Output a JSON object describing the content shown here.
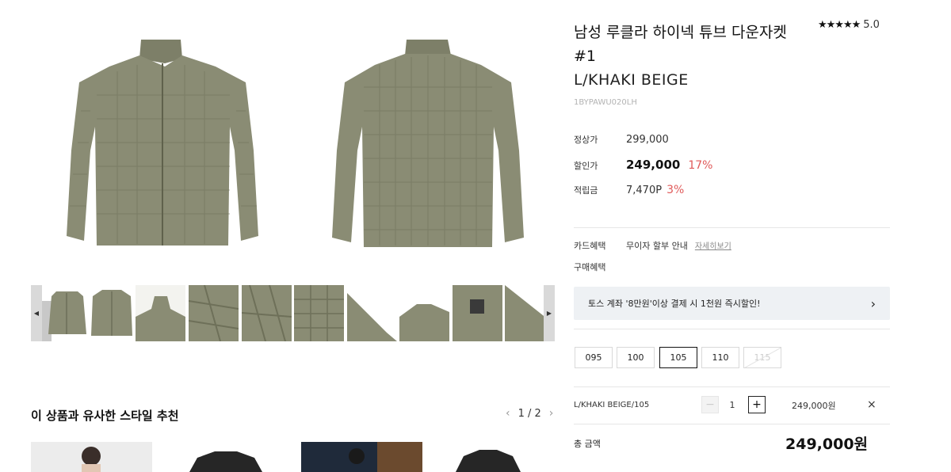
{
  "product": {
    "name_line1": "남성 루클라 하이넥 튜브 다운자켓",
    "name_line2": "#1",
    "color": "L/KHAKI BEIGE",
    "code": "1BYPAWU020LH",
    "rating_stars": "★★★★★",
    "rating_value": "5.0"
  },
  "prices": {
    "regular_label": "정상가",
    "regular_value": "299,000",
    "sale_label": "할인가",
    "sale_value": "249,000",
    "sale_pct": "17%",
    "points_label": "적립금",
    "points_value": "7,470P",
    "points_pct": "3%"
  },
  "benefits": {
    "card_label": "카드혜택",
    "card_value": "무이자 할부 안내",
    "card_link": "자세히보기",
    "purchase_label": "구매혜택"
  },
  "promo": {
    "text": "토스 계좌 '8만원'이상 결제 시 1천원 즉시할인!",
    "chevron": "›"
  },
  "sizes": [
    {
      "label": "095",
      "state": "normal"
    },
    {
      "label": "100",
      "state": "normal"
    },
    {
      "label": "105",
      "state": "selected"
    },
    {
      "label": "110",
      "state": "normal"
    },
    {
      "label": "115",
      "state": "disabled"
    }
  ],
  "selection": {
    "option": "L/KHAKI BEIGE/105",
    "minus": "−",
    "quantity": "1",
    "plus": "+",
    "price": "249,000원",
    "remove": "×"
  },
  "total": {
    "label": "총 금액",
    "value": "249,000원"
  },
  "recommend": {
    "title": "이 상품과 유사한 스타일 추천",
    "page": "1 / 2",
    "prev": "‹",
    "next": "›"
  },
  "thumbs": {
    "prev": "◀",
    "next": "▶"
  },
  "colors": {
    "jacket": "#8a8c74",
    "jacket_dark": "#6e7059",
    "discount": "#e05a5a"
  }
}
